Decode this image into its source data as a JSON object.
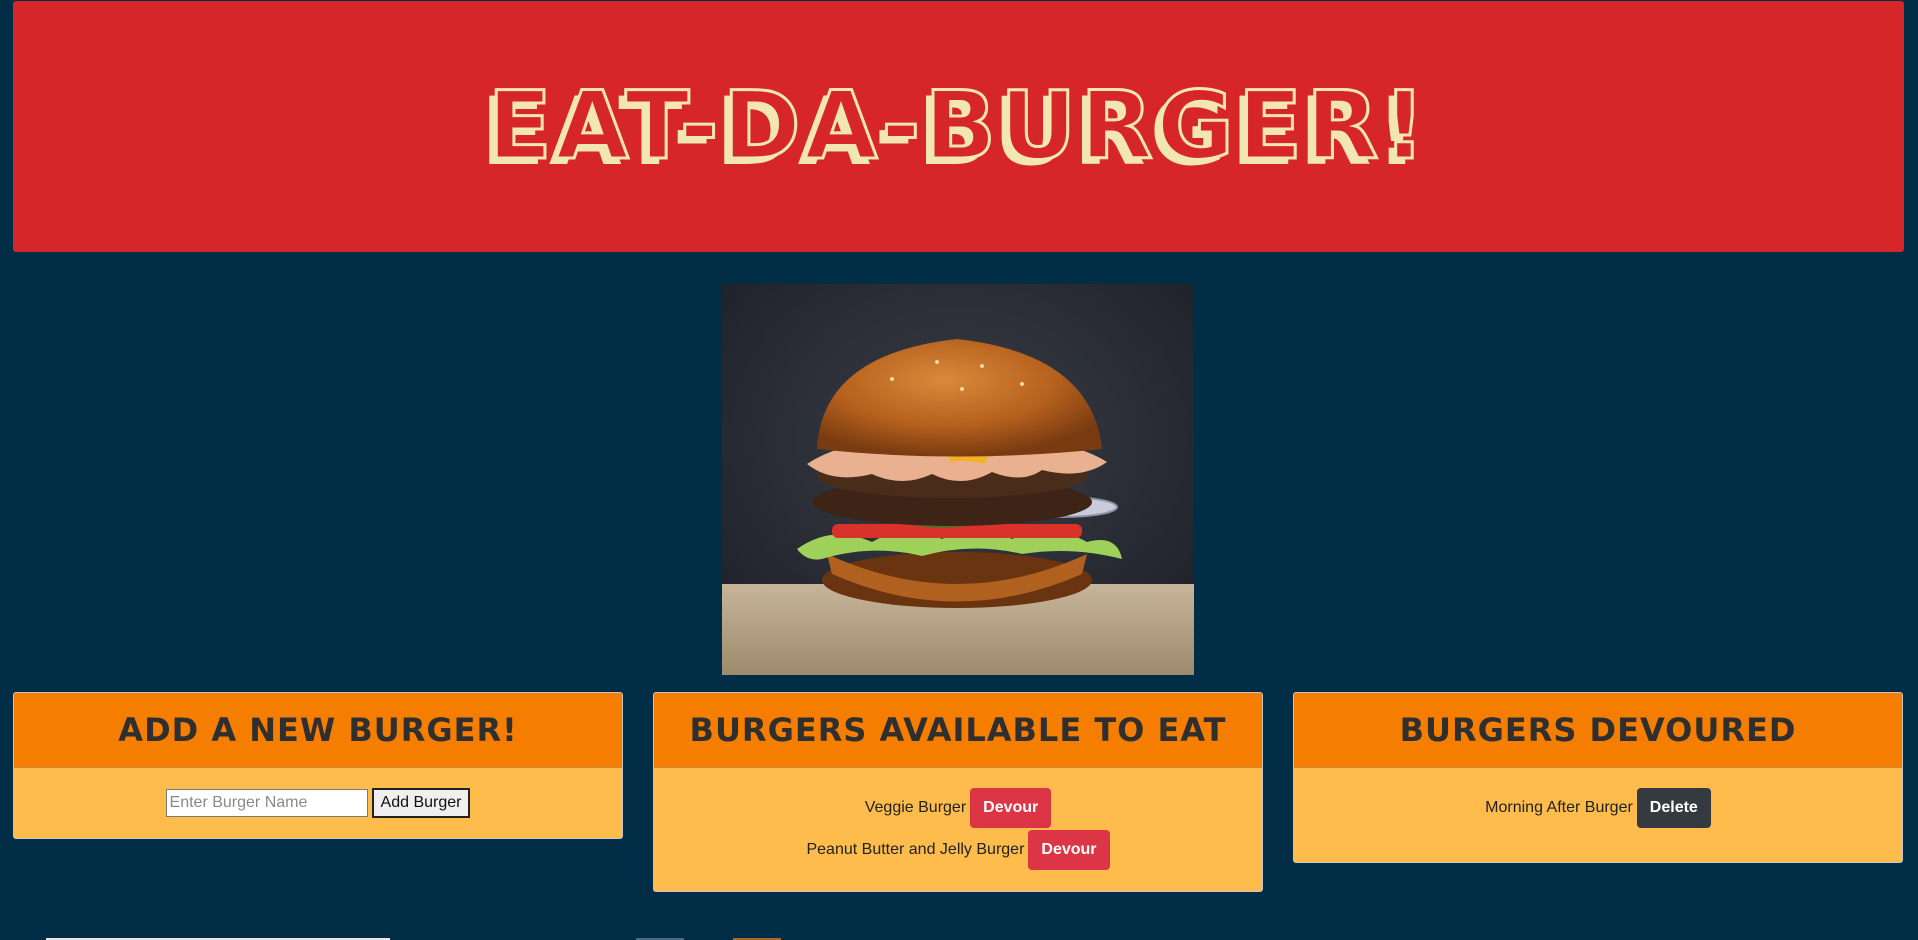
{
  "header": {
    "title": "EAT-DA-BURGER!"
  },
  "add_card": {
    "heading": "Add a New Burger!",
    "input_value": "",
    "input_placeholder": "Enter Burger Name",
    "submit_label": "Add Burger"
  },
  "available_card": {
    "heading": "Burgers Available to Eat",
    "items": [
      {
        "name": "Veggie Burger",
        "action": "Devour"
      },
      {
        "name": "Peanut Butter and Jelly Burger",
        "action": "Devour"
      }
    ]
  },
  "devoured_card": {
    "heading": "Burgers Devoured",
    "items": [
      {
        "name": "Morning After Burger",
        "action": "Delete"
      }
    ]
  },
  "colors": {
    "page_background": "#022d47",
    "header_background": "#d62629",
    "title_outline": "#f1e6b4",
    "card_header": "#f57e00",
    "card_body": "#fdbc4b",
    "devour_button": "#dc3545",
    "delete_button": "#343a40"
  }
}
